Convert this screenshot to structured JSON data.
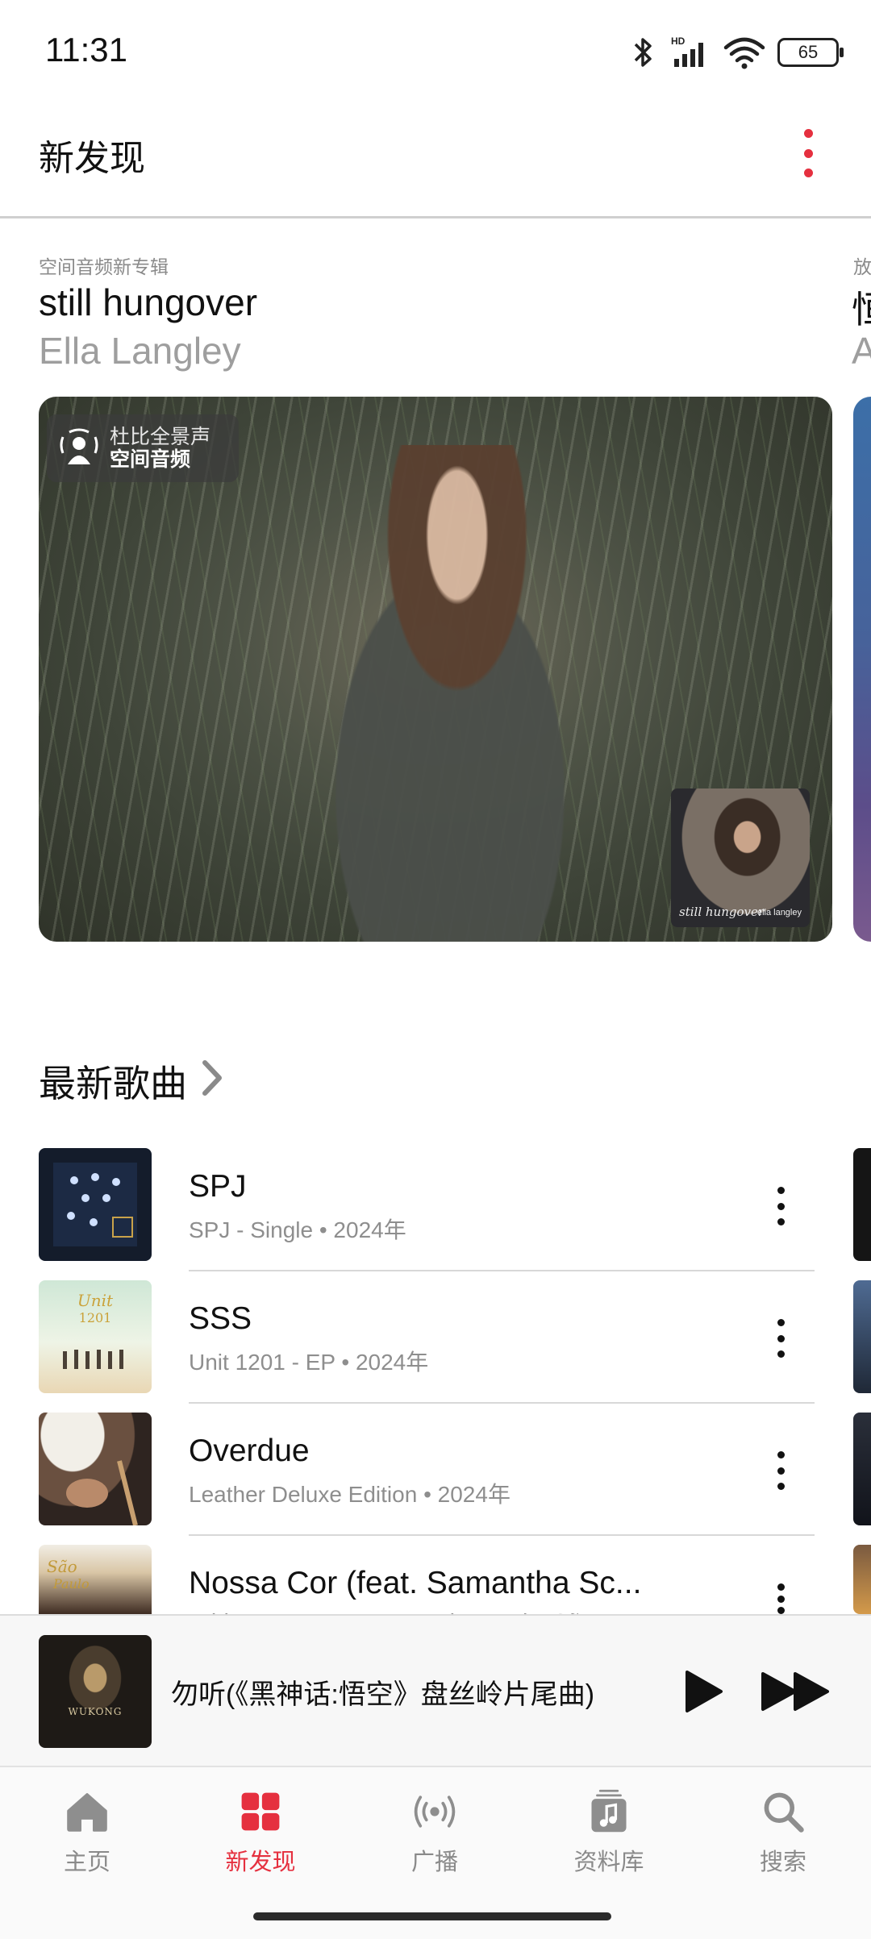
{
  "status_bar": {
    "time": "11:31",
    "battery": "65"
  },
  "header": {
    "title": "新发现"
  },
  "featured": {
    "kicker": "空间音频新专辑",
    "title": "still hungover",
    "artist": "Ella Langley",
    "badge_line1": "杜比全景声",
    "badge_line2": "空间音频",
    "thumb_text_left": "still hungover",
    "thumb_text_right": "ella langley",
    "peek_kicker": "放",
    "peek_title": "恒",
    "peek_artist": "A"
  },
  "latest_songs": {
    "title": "最新歌曲",
    "items": [
      {
        "title": "SPJ",
        "subtitle": "SPJ - Single • 2024年"
      },
      {
        "title": "SSS",
        "subtitle": "Unit 1201 - EP • 2024年"
      },
      {
        "title": "Overdue",
        "subtitle": "Leather Deluxe Edition • 2024年"
      },
      {
        "title": "Nossa Cor (feat. Samantha Sc...",
        "subtitle": "Adrian Younge Presents Lions Lake São..."
      }
    ]
  },
  "player": {
    "title": "勿听(《黑神话:悟空》盘丝岭片尾曲)",
    "art_caption": "WUKONG"
  },
  "tabs": [
    {
      "label": "主页",
      "icon": "home-icon"
    },
    {
      "label": "新发现",
      "icon": "grid-icon",
      "active": true
    },
    {
      "label": "广播",
      "icon": "radio-icon"
    },
    {
      "label": "资料库",
      "icon": "library-icon"
    },
    {
      "label": "搜索",
      "icon": "search-icon"
    }
  ],
  "colors": {
    "accent": "#e5303f",
    "secondary_text": "#8e8e8e"
  }
}
